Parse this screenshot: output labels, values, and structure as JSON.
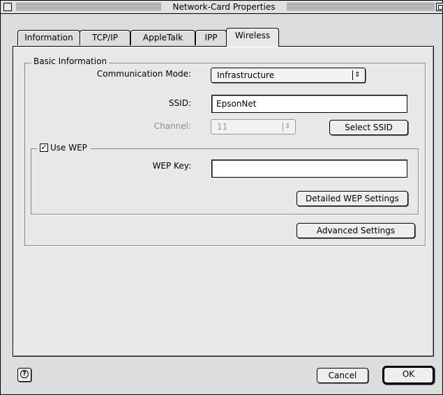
{
  "window": {
    "title": "Network-Card Properties"
  },
  "tabs": [
    {
      "label": "Information"
    },
    {
      "label": "TCP/IP"
    },
    {
      "label": "AppleTalk"
    },
    {
      "label": "IPP"
    },
    {
      "label": "Wireless",
      "active": true
    }
  ],
  "basic_info": {
    "group_label": "Basic Information",
    "comm_mode_label": "Communication Mode:",
    "comm_mode_value": "Infrastructure",
    "ssid_label": "SSID:",
    "ssid_value": "EpsonNet",
    "channel_label": "Channel:",
    "channel_value": "11",
    "select_ssid_button": "Select SSID"
  },
  "wep": {
    "checkbox_label": "Use WEP",
    "checked": true,
    "key_label": "WEP Key:",
    "key_value": "",
    "detailed_button": "Detailed WEP Settings"
  },
  "advanced_button": "Advanced Settings",
  "footer": {
    "cancel_button": "Cancel",
    "ok_button": "OK"
  },
  "icons": {
    "close": "close-box-icon",
    "zoom": "zoom-box-icon",
    "help": "help-icon",
    "popup_arrows": "updown-arrows-icon",
    "checkmark": "checkmark-icon"
  }
}
